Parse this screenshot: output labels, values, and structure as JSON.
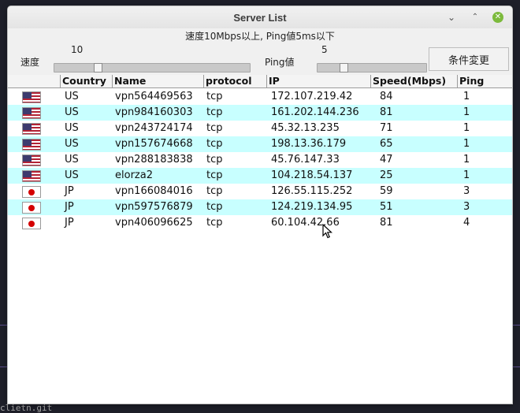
{
  "window": {
    "title": "Server List"
  },
  "condition_text": "速度10Mbps以上, Ping値5ms以下",
  "controls": {
    "speed_label": "速度",
    "speed_value": "10",
    "speed_fraction": 0.12,
    "ping_label": "Ping値",
    "ping_value": "5",
    "ping_fraction": 0.05,
    "change_button_label": "条件変更"
  },
  "table": {
    "columns": [
      "",
      "Country",
      "Name",
      "protocol",
      "IP",
      "Speed(Mbps)",
      "Ping"
    ],
    "rows": [
      {
        "flag": "us-flag-icon",
        "country": "US",
        "name": "vpn564469563",
        "protocol": "tcp",
        "ip": "172.107.219.42",
        "speed": "84",
        "ping": "1"
      },
      {
        "flag": "us-flag-icon",
        "country": "US",
        "name": "vpn984160303",
        "protocol": "tcp",
        "ip": "161.202.144.236",
        "speed": "81",
        "ping": "1"
      },
      {
        "flag": "us-flag-icon",
        "country": "US",
        "name": "vpn243724174",
        "protocol": "tcp",
        "ip": "45.32.13.235",
        "speed": "71",
        "ping": "1"
      },
      {
        "flag": "us-flag-icon",
        "country": "US",
        "name": "vpn157674668",
        "protocol": "tcp",
        "ip": "198.13.36.179",
        "speed": "65",
        "ping": "1"
      },
      {
        "flag": "us-flag-icon",
        "country": "US",
        "name": "vpn288183838",
        "protocol": "tcp",
        "ip": "45.76.147.33",
        "speed": "47",
        "ping": "1"
      },
      {
        "flag": "us-flag-icon",
        "country": "US",
        "name": "elorza2",
        "protocol": "tcp",
        "ip": "104.218.54.137",
        "speed": "25",
        "ping": "1"
      },
      {
        "flag": "jp-flag-icon",
        "country": "JP",
        "name": "vpn166084016",
        "protocol": "tcp",
        "ip": "126.55.115.252",
        "speed": "59",
        "ping": "3"
      },
      {
        "flag": "jp-flag-icon",
        "country": "JP",
        "name": "vpn597576879",
        "protocol": "tcp",
        "ip": "124.219.134.95",
        "speed": "51",
        "ping": "3"
      },
      {
        "flag": "jp-flag-icon",
        "country": "JP",
        "name": "vpn406096625",
        "protocol": "tcp",
        "ip": "60.104.42.66",
        "speed": "81",
        "ping": "4"
      }
    ]
  },
  "background": {
    "bottom_text": "clietn.git"
  },
  "colors": {
    "alt_row": "#c8ffff",
    "close_button": "#7cba3c"
  }
}
